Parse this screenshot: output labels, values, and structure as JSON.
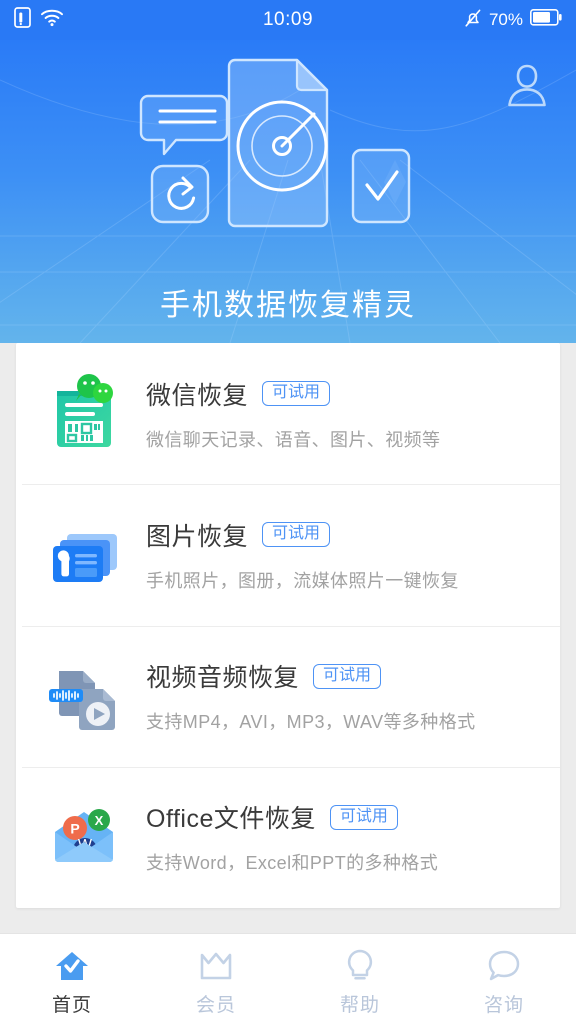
{
  "status_bar": {
    "icons_left": [
      "sim-card-icon",
      "wifi-icon"
    ],
    "time": "10:09",
    "mute_icon": "bell-off-icon",
    "battery_text": "70%",
    "battery_icon": "battery-icon",
    "background_color": "#2979f5"
  },
  "hero": {
    "title": "手机数据恢复精灵",
    "avatar_icon": "user-avatar-icon",
    "art_icons": [
      "chat-bubble-icon",
      "refresh-icon",
      "document-scan-icon",
      "checkmark-box-icon"
    ],
    "gradient_from": "#2a7bf7",
    "gradient_to": "#63b4ec"
  },
  "features": [
    {
      "icon": "wechat-recovery-icon",
      "title": "微信恢复",
      "badge": "可试用",
      "subtitle": "微信聊天记录、语音、图片、视频等"
    },
    {
      "icon": "photo-recovery-icon",
      "title": "图片恢复",
      "badge": "可试用",
      "subtitle": "手机照片，图册，流媒体照片一键恢复"
    },
    {
      "icon": "video-audio-recovery-icon",
      "title": "视频音频恢复",
      "badge": "可试用",
      "subtitle": "支持MP4，AVI，MP3，WAV等多种格式"
    },
    {
      "icon": "office-file-recovery-icon",
      "title": "Office文件恢复",
      "badge": "可试用",
      "subtitle": "支持Word，Excel和PPT的多种格式"
    }
  ],
  "bottom_nav": {
    "active_index": 0,
    "active_color": "#4a9cf0",
    "inactive_color": "#c3d2e6",
    "items": [
      {
        "icon": "home-check-icon",
        "label": "首页"
      },
      {
        "icon": "crown-icon",
        "label": "会员"
      },
      {
        "icon": "lightbulb-icon",
        "label": "帮助"
      },
      {
        "icon": "chat-bubble-icon",
        "label": "咨询"
      }
    ]
  }
}
